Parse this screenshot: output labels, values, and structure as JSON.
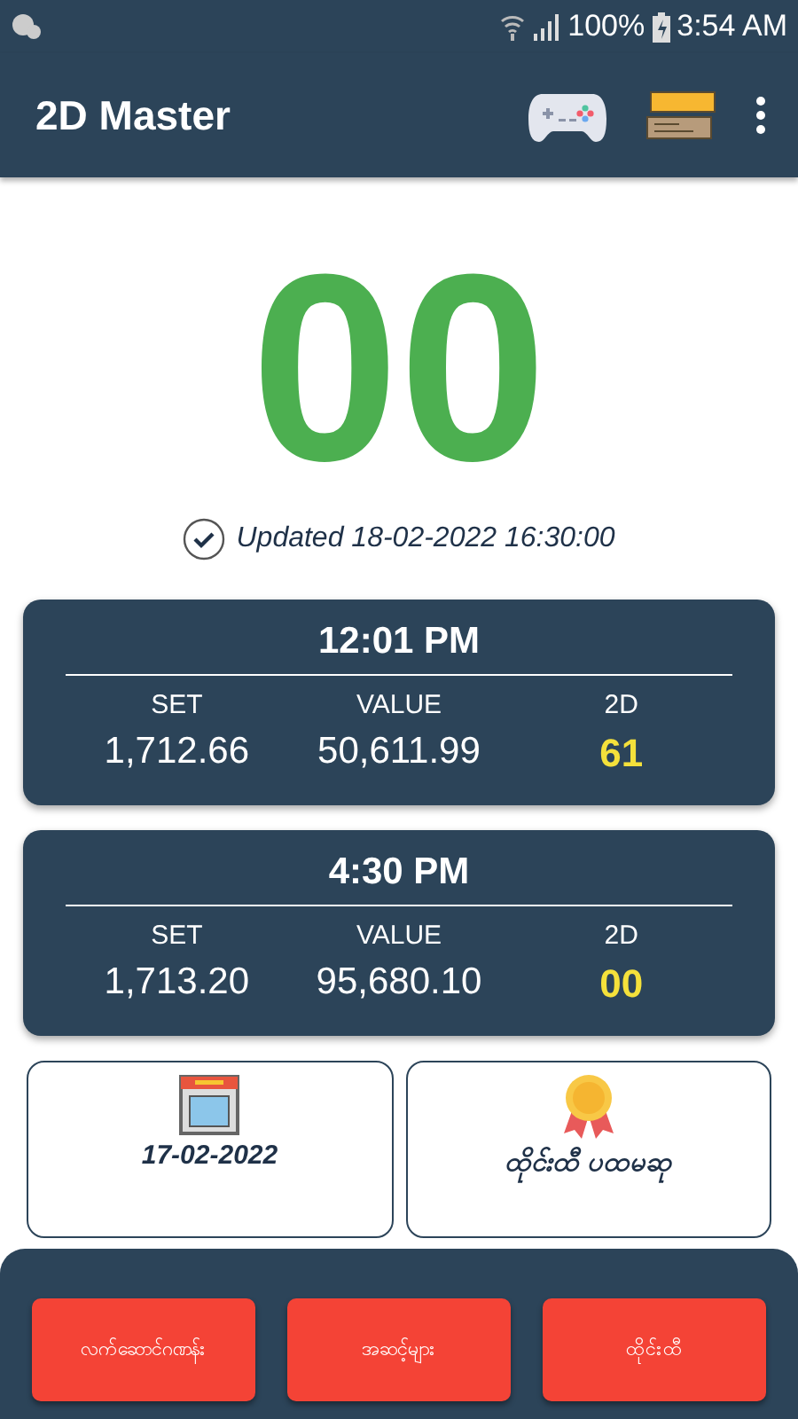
{
  "status_bar": {
    "battery": "100%",
    "time": "3:54 AM"
  },
  "app_bar": {
    "title": "2D Master"
  },
  "result": {
    "number": "00",
    "updated": "Updated 18-02-2022 16:30:00"
  },
  "sessions": [
    {
      "time": "12:01 PM",
      "labels": [
        "SET",
        "VALUE",
        "2D"
      ],
      "set": "1,712.66",
      "value": "50,611.99",
      "twod": "61"
    },
    {
      "time": "4:30 PM",
      "labels": [
        "SET",
        "VALUE",
        "2D"
      ],
      "set": "1,713.20",
      "value": "95,680.10",
      "twod": "00"
    }
  ],
  "tiles": [
    {
      "kind": "threed",
      "caption": "17-02-2022"
    },
    {
      "kind": "medal",
      "caption": "ထိုင်းထီ ပထမဆု"
    }
  ],
  "bottom_buttons": [
    "လက်ဆောင်ဂဏန်း",
    "အဆင့်များ",
    "ထိုင်းထီ"
  ]
}
